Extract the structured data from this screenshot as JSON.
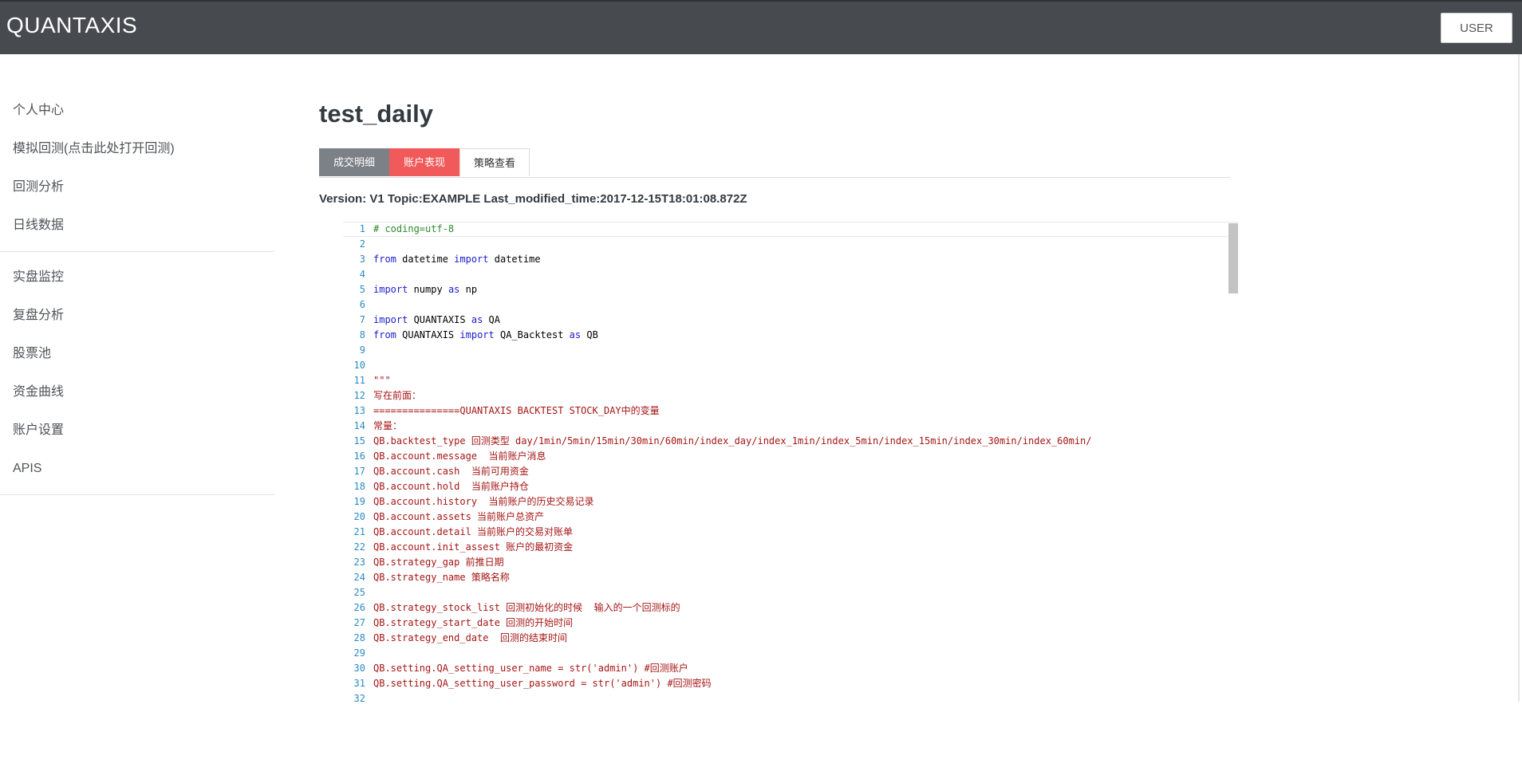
{
  "app": {
    "brand": "QUANTAXIS",
    "user_button": "USER"
  },
  "sidebar": {
    "group1": [
      "个人中心",
      "模拟回测(点击此处打开回测)",
      "回测分析",
      "日线数据"
    ],
    "group2": [
      "实盘监控",
      "复盘分析",
      "股票池",
      "资金曲线",
      "账户设置",
      "APIS"
    ]
  },
  "main": {
    "title": "test_daily",
    "tabs": [
      "成交明细",
      "账户表现",
      "策略查看"
    ],
    "version_line": "Version: V1 Topic:EXAMPLE Last_modified_time:2017-12-15T18:01:08.872Z"
  },
  "code_lines": [
    {
      "n": "1",
      "t": "# coding=utf-8",
      "type": "comment"
    },
    {
      "n": "2",
      "t": "",
      "type": "plain"
    },
    {
      "n": "3",
      "t": "from datetime import datetime",
      "type": "import"
    },
    {
      "n": "4",
      "t": "",
      "type": "plain"
    },
    {
      "n": "5",
      "t": "import numpy as np",
      "type": "import"
    },
    {
      "n": "6",
      "t": "",
      "type": "plain"
    },
    {
      "n": "7",
      "t": "import QUANTAXIS as QA",
      "type": "import"
    },
    {
      "n": "8",
      "t": "from QUANTAXIS import QA_Backtest as QB",
      "type": "import"
    },
    {
      "n": "9",
      "t": "",
      "type": "plain"
    },
    {
      "n": "10",
      "t": "",
      "type": "plain"
    },
    {
      "n": "11",
      "t": "\"\"\"",
      "type": "string"
    },
    {
      "n": "12",
      "t": "写在前面：",
      "type": "string"
    },
    {
      "n": "13",
      "t": "===============QUANTAXIS BACKTEST STOCK_DAY中的变量",
      "type": "string"
    },
    {
      "n": "14",
      "t": "常量：",
      "type": "string"
    },
    {
      "n": "15",
      "t": "QB.backtest_type 回测类型 day/1min/5min/15min/30min/60min/index_day/index_1min/index_5min/index_15min/index_30min/index_60min/",
      "type": "string"
    },
    {
      "n": "16",
      "t": "QB.account.message  当前账户消息",
      "type": "string"
    },
    {
      "n": "17",
      "t": "QB.account.cash  当前可用资金",
      "type": "string"
    },
    {
      "n": "18",
      "t": "QB.account.hold  当前账户持仓",
      "type": "string"
    },
    {
      "n": "19",
      "t": "QB.account.history  当前账户的历史交易记录",
      "type": "string"
    },
    {
      "n": "20",
      "t": "QB.account.assets 当前账户总资产",
      "type": "string"
    },
    {
      "n": "21",
      "t": "QB.account.detail 当前账户的交易对账单",
      "type": "string"
    },
    {
      "n": "22",
      "t": "QB.account.init_assest 账户的最初资金",
      "type": "string"
    },
    {
      "n": "23",
      "t": "QB.strategy_gap 前推日期",
      "type": "string"
    },
    {
      "n": "24",
      "t": "QB.strategy_name 策略名称",
      "type": "string"
    },
    {
      "n": "25",
      "t": "",
      "type": "string"
    },
    {
      "n": "26",
      "t": "QB.strategy_stock_list 回测初始化的时候  输入的一个回测标的",
      "type": "string"
    },
    {
      "n": "27",
      "t": "QB.strategy_start_date 回测的开始时间",
      "type": "string"
    },
    {
      "n": "28",
      "t": "QB.strategy_end_date  回测的结束时间",
      "type": "string"
    },
    {
      "n": "29",
      "t": "",
      "type": "string"
    },
    {
      "n": "30",
      "t": "QB.setting.QA_setting_user_name = str('admin') #回测账户",
      "type": "string"
    },
    {
      "n": "31",
      "t": "QB.setting.QA_setting_user_password = str('admin') #回测密码",
      "type": "string"
    },
    {
      "n": "32",
      "t": "",
      "type": "string"
    }
  ]
}
